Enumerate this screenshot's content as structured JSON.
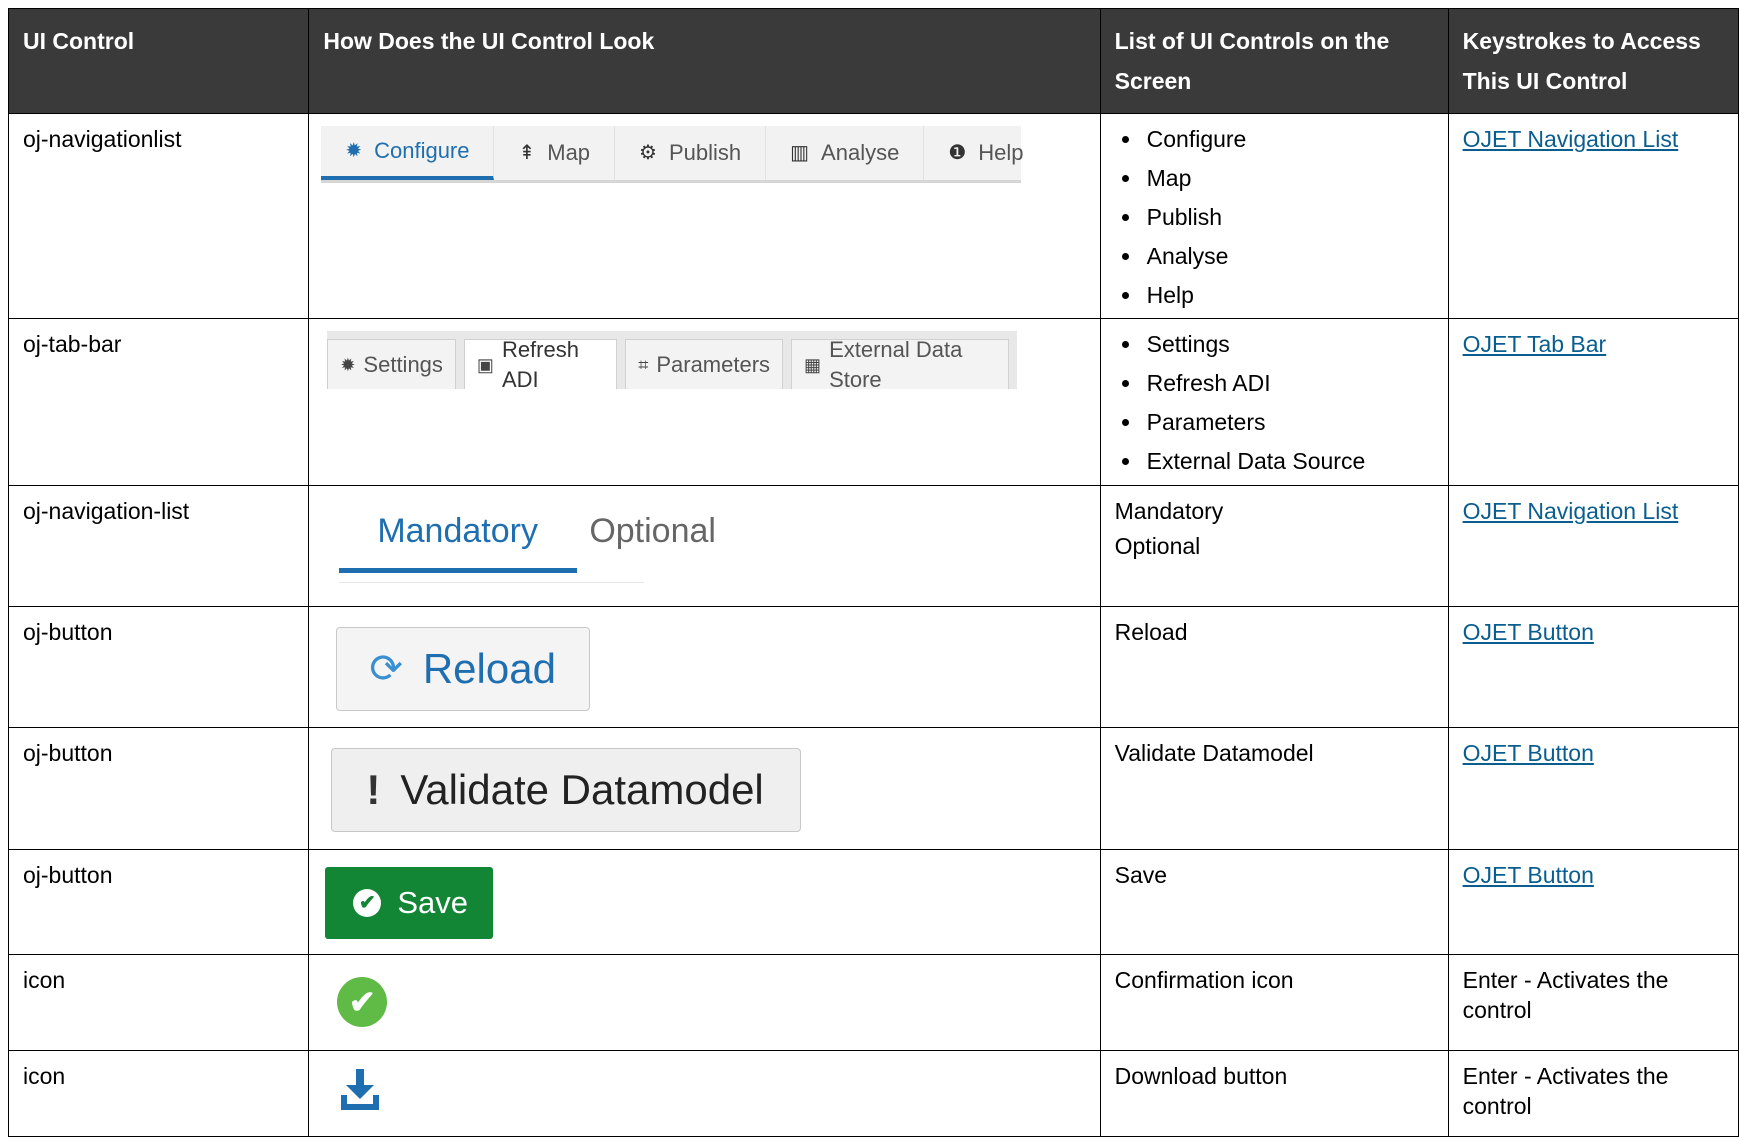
{
  "headers": {
    "col1": "UI Control",
    "col2": "How Does the UI Control Look",
    "col3": "List of UI Controls on the Screen",
    "col4": "Keystrokes to Access This UI Control"
  },
  "rows": [
    {
      "control": "oj-navigationlist",
      "list": [
        "Configure",
        "Map",
        "Publish",
        "Analyse",
        "Help"
      ],
      "link": "OJET Navigation List",
      "preview": {
        "items": [
          {
            "label": "Configure",
            "icon": "gear-icon",
            "glyph": "✹"
          },
          {
            "label": "Map",
            "icon": "signpost-icon",
            "glyph": "⇞"
          },
          {
            "label": "Publish",
            "icon": "gears-icon",
            "glyph": "⚙"
          },
          {
            "label": "Analyse",
            "icon": "bar-chart-icon",
            "glyph": "▥"
          },
          {
            "label": "Help",
            "icon": "info-icon",
            "glyph": "❶"
          }
        ]
      }
    },
    {
      "control": "oj-tab-bar",
      "list": [
        "Settings",
        "Refresh ADI",
        "Parameters",
        "External Data Source"
      ],
      "link": "OJET Tab Bar",
      "preview": {
        "tabs": [
          {
            "label": "Settings",
            "icon": "gear-icon",
            "glyph": "✹"
          },
          {
            "label": "Refresh ADI",
            "icon": "caret-square-icon",
            "glyph": "▣"
          },
          {
            "label": "Parameters",
            "icon": "crop-icon",
            "glyph": "⌗"
          },
          {
            "label": "External Data Store",
            "icon": "briefcase-icon",
            "glyph": "▦"
          }
        ]
      }
    },
    {
      "control": "oj-navigation-list",
      "list": [
        "Mandatory",
        "Optional"
      ],
      "link": "OJET Navigation List",
      "preview": {
        "items": [
          "Mandatory",
          "Optional"
        ]
      }
    },
    {
      "control": "oj-button",
      "list": [
        "Reload"
      ],
      "link": "OJET Button",
      "preview": {
        "label": "Reload",
        "icon": "refresh-icon",
        "glyph": "⟳"
      }
    },
    {
      "control": "oj-button",
      "list": [
        "Validate Datamodel"
      ],
      "link": "OJET Button",
      "preview": {
        "label": "Validate Datamodel",
        "icon": "exclamation-icon",
        "glyph": "!"
      }
    },
    {
      "control": "oj-button",
      "list": [
        "Save"
      ],
      "link": "OJET Button",
      "preview": {
        "label": "Save",
        "icon": "check-circle-icon",
        "glyph": "✔"
      }
    },
    {
      "control": "icon",
      "list": [
        "Confirmation icon"
      ],
      "keystroke": "Enter - Activates the control",
      "preview": {
        "icon": "confirmation-check-icon",
        "glyph": "✔"
      }
    },
    {
      "control": "icon",
      "list": [
        "Download button"
      ],
      "keystroke": "Enter - Activates the control",
      "preview": {
        "icon": "download-icon"
      }
    }
  ],
  "colors": {
    "header_bg": "#3a3a3a",
    "link": "#0a5e8f",
    "accent_blue": "#1f6fb0",
    "save_green": "#138636",
    "confirm_green": "#5fba46"
  }
}
